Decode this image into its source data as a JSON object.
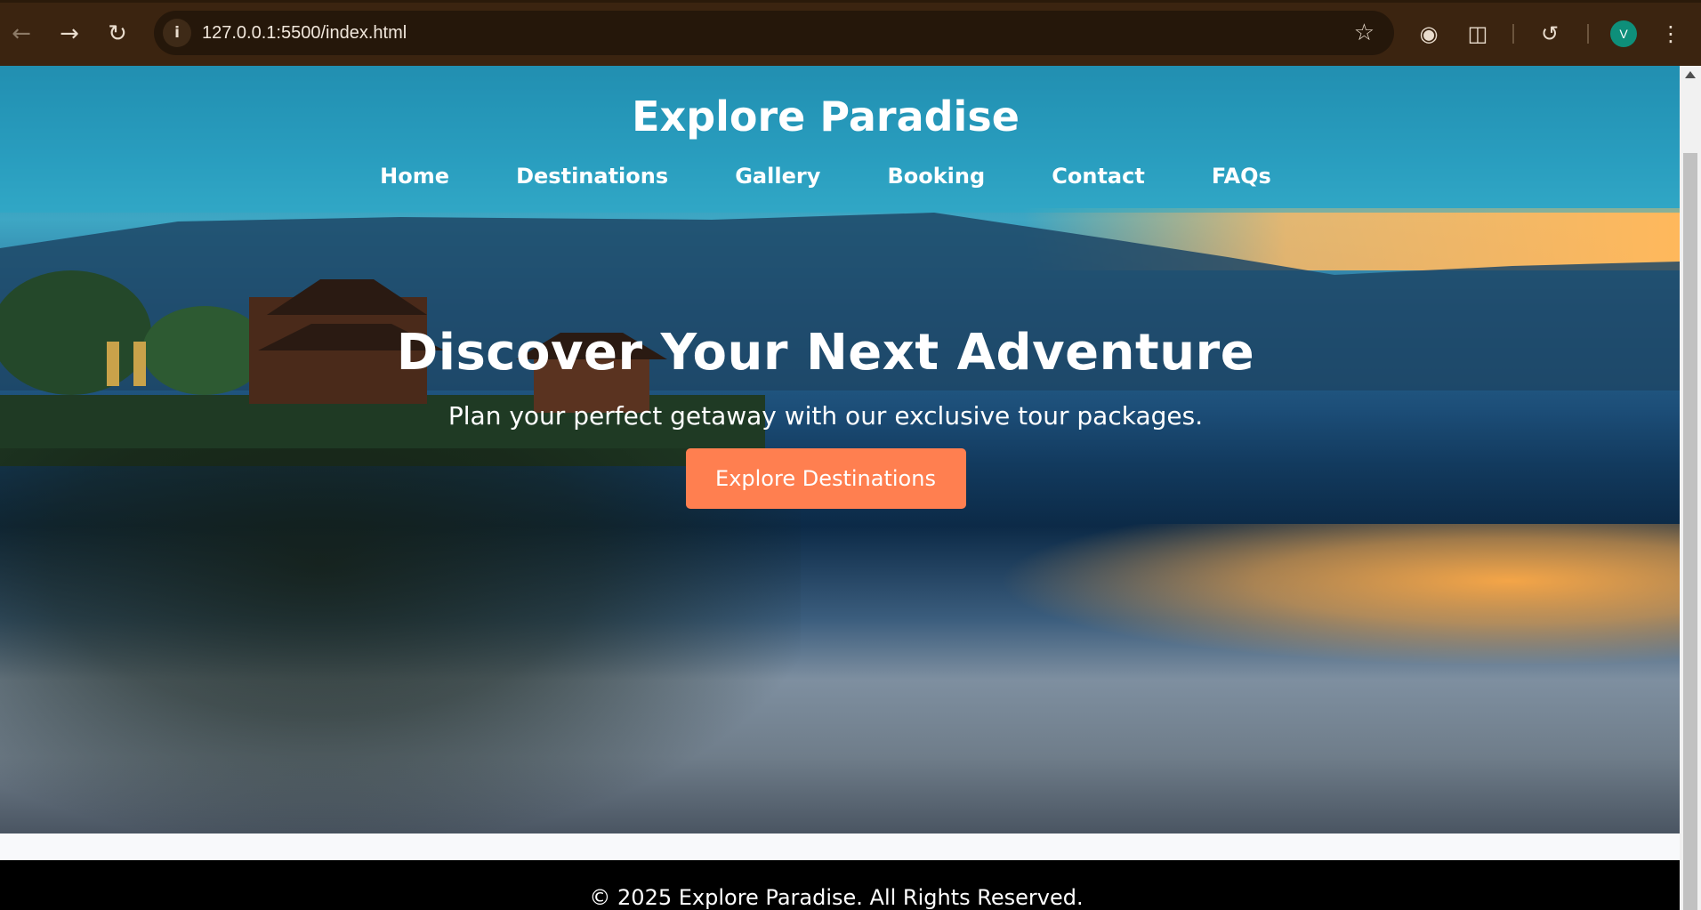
{
  "browser": {
    "url": "127.0.0.1:5500/index.html",
    "profile_initial": "V"
  },
  "site": {
    "title": "Explore Paradise",
    "nav": [
      "Home",
      "Destinations",
      "Gallery",
      "Booking",
      "Contact",
      "FAQs"
    ]
  },
  "hero": {
    "title": "Discover Your Next Adventure",
    "subtitle": "Plan your perfect getaway with our exclusive tour packages.",
    "button_label": "Explore Destinations",
    "button_color": "#ff7f50"
  },
  "footer": {
    "text": "© 2025 Explore Paradise. All Rights Reserved."
  }
}
